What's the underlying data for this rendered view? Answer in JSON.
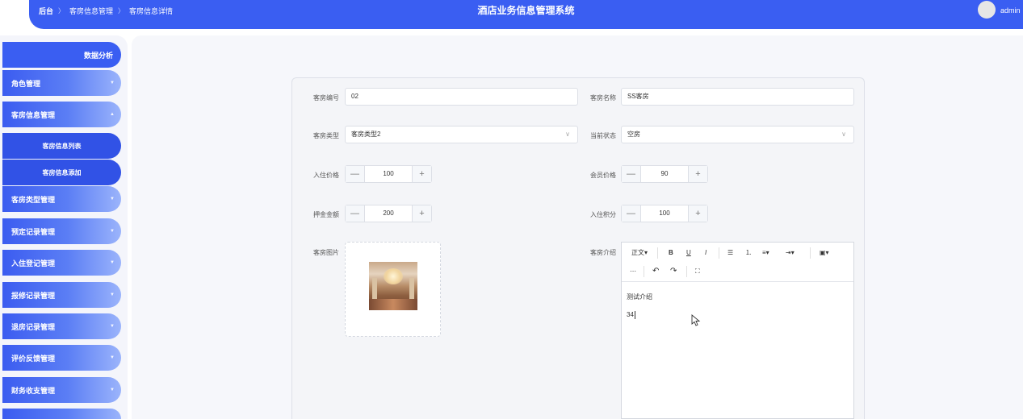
{
  "header": {
    "breadcrumb": [
      "后台",
      "客房信息管理",
      "客房信息详情"
    ],
    "separator": "〉",
    "title": "酒店业务信息管理系统",
    "user": "admin",
    "accent": "#3a5ef2"
  },
  "sidebar": {
    "top_item": "数据分析",
    "items": [
      {
        "label": "角色管理"
      },
      {
        "label": "客房信息管理"
      },
      {
        "label": "客房信息列表"
      },
      {
        "label": "客房信息添加"
      },
      {
        "label": "客房类型管理"
      },
      {
        "label": "预定记录管理"
      },
      {
        "label": "入住登记管理"
      },
      {
        "label": "报修记录管理"
      },
      {
        "label": "退房记录管理"
      },
      {
        "label": "评价反馈管理"
      },
      {
        "label": "财务收支管理"
      }
    ],
    "chevron_down": "▼",
    "chevron_up": "▲"
  },
  "form": {
    "room_no": {
      "label": "客房编号",
      "value": "02"
    },
    "room_name": {
      "label": "客房名称",
      "value": "SS客房"
    },
    "room_type": {
      "label": "客房类型",
      "value": "客房类型2",
      "arrow": "∨"
    },
    "status": {
      "label": "当前状态",
      "value": "空房",
      "arrow": "∨"
    },
    "checkin_price": {
      "label": "入住价格",
      "value": "100"
    },
    "member_price": {
      "label": "会员价格",
      "value": "90"
    },
    "deposit": {
      "label": "押金金额",
      "value": "200"
    },
    "points": {
      "label": "入住积分",
      "value": "100"
    },
    "image": {
      "label": "客房图片"
    },
    "intro": {
      "label": "客房介绍",
      "lines": [
        "测试介绍",
        "34"
      ]
    },
    "minus": "—",
    "plus": "+"
  },
  "editor_toolbar": {
    "heading": "正文▾",
    "bold": "B",
    "underline": "U",
    "italic": "I",
    "bullet_list": "☰",
    "numbered_list": "⒈",
    "align": "≡▾",
    "indent": "⇥▾",
    "image": "▣▾",
    "divider": "⋯",
    "undo": "↶",
    "redo": "↷",
    "fullscreen": "⛶"
  }
}
